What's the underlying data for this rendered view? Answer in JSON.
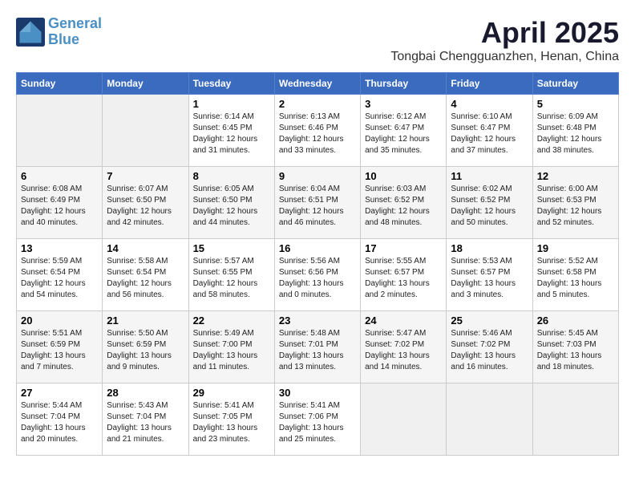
{
  "header": {
    "logo_line1": "General",
    "logo_line2": "Blue",
    "month_title": "April 2025",
    "location": "Tongbai Chengguanzhen, Henan, China"
  },
  "days_of_week": [
    "Sunday",
    "Monday",
    "Tuesday",
    "Wednesday",
    "Thursday",
    "Friday",
    "Saturday"
  ],
  "weeks": [
    [
      {
        "day": null,
        "content": null
      },
      {
        "day": null,
        "content": null
      },
      {
        "day": "1",
        "content": "Sunrise: 6:14 AM\nSunset: 6:45 PM\nDaylight: 12 hours and 31 minutes."
      },
      {
        "day": "2",
        "content": "Sunrise: 6:13 AM\nSunset: 6:46 PM\nDaylight: 12 hours and 33 minutes."
      },
      {
        "day": "3",
        "content": "Sunrise: 6:12 AM\nSunset: 6:47 PM\nDaylight: 12 hours and 35 minutes."
      },
      {
        "day": "4",
        "content": "Sunrise: 6:10 AM\nSunset: 6:47 PM\nDaylight: 12 hours and 37 minutes."
      },
      {
        "day": "5",
        "content": "Sunrise: 6:09 AM\nSunset: 6:48 PM\nDaylight: 12 hours and 38 minutes."
      }
    ],
    [
      {
        "day": "6",
        "content": "Sunrise: 6:08 AM\nSunset: 6:49 PM\nDaylight: 12 hours and 40 minutes."
      },
      {
        "day": "7",
        "content": "Sunrise: 6:07 AM\nSunset: 6:50 PM\nDaylight: 12 hours and 42 minutes."
      },
      {
        "day": "8",
        "content": "Sunrise: 6:05 AM\nSunset: 6:50 PM\nDaylight: 12 hours and 44 minutes."
      },
      {
        "day": "9",
        "content": "Sunrise: 6:04 AM\nSunset: 6:51 PM\nDaylight: 12 hours and 46 minutes."
      },
      {
        "day": "10",
        "content": "Sunrise: 6:03 AM\nSunset: 6:52 PM\nDaylight: 12 hours and 48 minutes."
      },
      {
        "day": "11",
        "content": "Sunrise: 6:02 AM\nSunset: 6:52 PM\nDaylight: 12 hours and 50 minutes."
      },
      {
        "day": "12",
        "content": "Sunrise: 6:00 AM\nSunset: 6:53 PM\nDaylight: 12 hours and 52 minutes."
      }
    ],
    [
      {
        "day": "13",
        "content": "Sunrise: 5:59 AM\nSunset: 6:54 PM\nDaylight: 12 hours and 54 minutes."
      },
      {
        "day": "14",
        "content": "Sunrise: 5:58 AM\nSunset: 6:54 PM\nDaylight: 12 hours and 56 minutes."
      },
      {
        "day": "15",
        "content": "Sunrise: 5:57 AM\nSunset: 6:55 PM\nDaylight: 12 hours and 58 minutes."
      },
      {
        "day": "16",
        "content": "Sunrise: 5:56 AM\nSunset: 6:56 PM\nDaylight: 13 hours and 0 minutes."
      },
      {
        "day": "17",
        "content": "Sunrise: 5:55 AM\nSunset: 6:57 PM\nDaylight: 13 hours and 2 minutes."
      },
      {
        "day": "18",
        "content": "Sunrise: 5:53 AM\nSunset: 6:57 PM\nDaylight: 13 hours and 3 minutes."
      },
      {
        "day": "19",
        "content": "Sunrise: 5:52 AM\nSunset: 6:58 PM\nDaylight: 13 hours and 5 minutes."
      }
    ],
    [
      {
        "day": "20",
        "content": "Sunrise: 5:51 AM\nSunset: 6:59 PM\nDaylight: 13 hours and 7 minutes."
      },
      {
        "day": "21",
        "content": "Sunrise: 5:50 AM\nSunset: 6:59 PM\nDaylight: 13 hours and 9 minutes."
      },
      {
        "day": "22",
        "content": "Sunrise: 5:49 AM\nSunset: 7:00 PM\nDaylight: 13 hours and 11 minutes."
      },
      {
        "day": "23",
        "content": "Sunrise: 5:48 AM\nSunset: 7:01 PM\nDaylight: 13 hours and 13 minutes."
      },
      {
        "day": "24",
        "content": "Sunrise: 5:47 AM\nSunset: 7:02 PM\nDaylight: 13 hours and 14 minutes."
      },
      {
        "day": "25",
        "content": "Sunrise: 5:46 AM\nSunset: 7:02 PM\nDaylight: 13 hours and 16 minutes."
      },
      {
        "day": "26",
        "content": "Sunrise: 5:45 AM\nSunset: 7:03 PM\nDaylight: 13 hours and 18 minutes."
      }
    ],
    [
      {
        "day": "27",
        "content": "Sunrise: 5:44 AM\nSunset: 7:04 PM\nDaylight: 13 hours and 20 minutes."
      },
      {
        "day": "28",
        "content": "Sunrise: 5:43 AM\nSunset: 7:04 PM\nDaylight: 13 hours and 21 minutes."
      },
      {
        "day": "29",
        "content": "Sunrise: 5:41 AM\nSunset: 7:05 PM\nDaylight: 13 hours and 23 minutes."
      },
      {
        "day": "30",
        "content": "Sunrise: 5:41 AM\nSunset: 7:06 PM\nDaylight: 13 hours and 25 minutes."
      },
      {
        "day": null,
        "content": null
      },
      {
        "day": null,
        "content": null
      },
      {
        "day": null,
        "content": null
      }
    ]
  ]
}
